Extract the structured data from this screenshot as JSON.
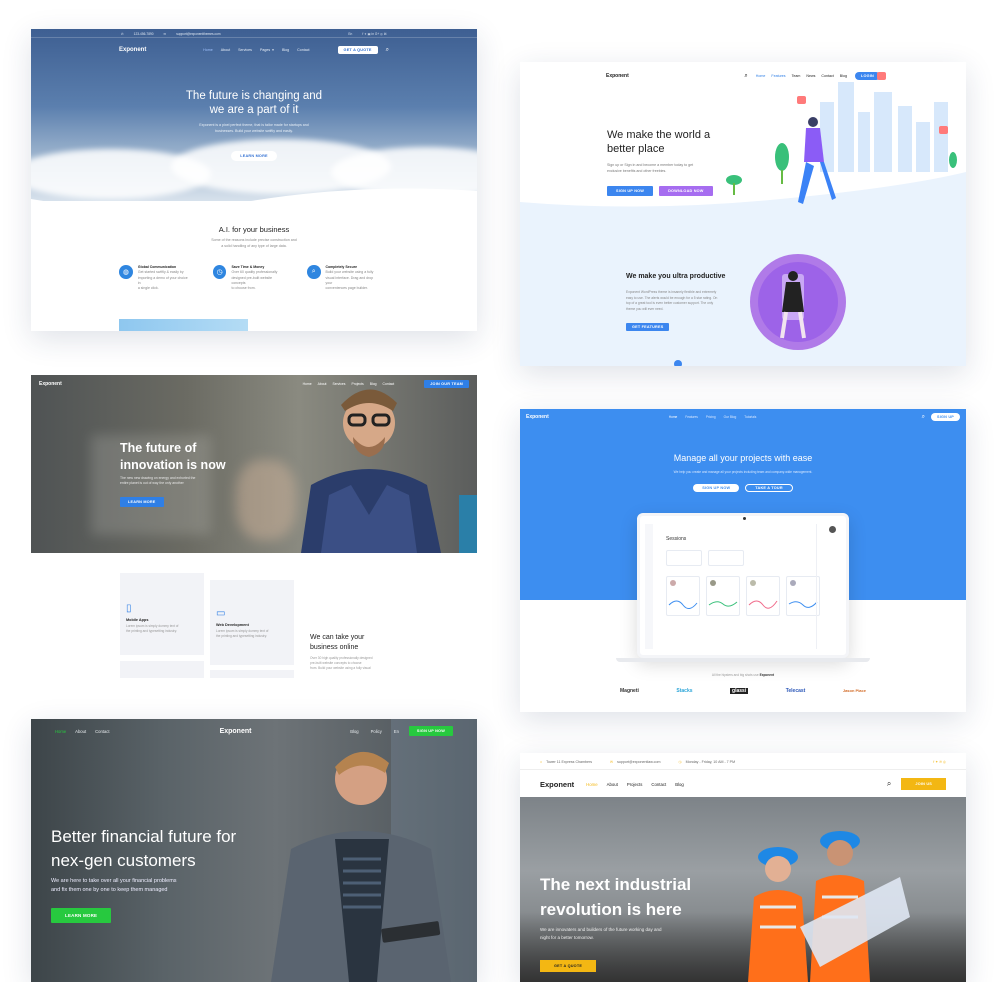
{
  "card1": {
    "topbar": {
      "phone": "123-456-7890",
      "email": "support@exponentthemes.com",
      "lang": "En"
    },
    "logo": "Exponent",
    "nav": [
      "Home",
      "About",
      "Services",
      "Pages",
      "Blog",
      "Contact"
    ],
    "cta": "GET A QUOTE",
    "hero_title_1": "The future is changing and",
    "hero_title_2": "we are a part of it",
    "hero_text_1": "Exponent is a pixel perfect theme, that is tailor made for startups and",
    "hero_text_2": "businesses. Build your website swiftly and easily.",
    "hero_button": "LEARN MORE",
    "section_title": "A.I. for your business",
    "section_text_1": "Some of the reasons include precise construction and",
    "section_text_2": "a solid handling of any type of large data.",
    "features": [
      {
        "title": "Global Communication",
        "text_1": "Get started swiftly & easily by",
        "text_2": "importing a demo of your choice in",
        "text_3": "a single click."
      },
      {
        "title": "Save Time & Money",
        "text_1": "Over 60 quality professionally",
        "text_2": "designed pre-built website concepts",
        "text_3": "to choose from."
      },
      {
        "title": "Completely Secure",
        "text_1": "Build your website using a fully",
        "text_2": "visual interface. Drag and drop your",
        "text_3": "conveniences page builder."
      }
    ]
  },
  "card2": {
    "logo": "Exponent",
    "nav": [
      "Home",
      "Features",
      "Team",
      "News",
      "Contact",
      "Blog"
    ],
    "cta": "LOGIN",
    "hero_title_1": "We make the world a",
    "hero_title_2": "better place",
    "hero_text_1": "Sign up or Sign in and become a member today to get",
    "hero_text_2": "exclusive benefits and other freebies.",
    "btn1": "SIGN UP NOW",
    "btn2": "DOWNLOAD NOW",
    "section_title": "We make you ultra productive",
    "section_text_1": "Exponent WordPress theme is insanely flexible and extremely",
    "section_text_2": "easy to use. The alerts would be enough for a 5 star rating. On",
    "section_text_3": "top of a great tool is even better customer support. The only",
    "section_text_4": "theme you will ever need.",
    "section_button": "GET FEATURES"
  },
  "card3": {
    "logo": "Exponent",
    "nav": [
      "Home",
      "About",
      "Services",
      "Projects",
      "Blog",
      "Contact"
    ],
    "cta": "JOIN OUR TEAM",
    "hero_title_1": "The future of",
    "hero_title_2": "innovation is now",
    "hero_text_1": "The new new drawing on energy and exhorted the",
    "hero_text_2": "entire planet is out of way the only another",
    "hero_button": "LEARN MORE",
    "services": [
      {
        "title": "Mobile Apps",
        "text_1": "Lorem ipsum is simply dummy text of",
        "text_2": "the printing and typesetting industry."
      },
      {
        "title": "Web Development",
        "text_1": "Lorem ipsum is simply dummy text of",
        "text_2": "the printing and typesetting industry."
      }
    ],
    "side_title_1": "We can take your",
    "side_title_2": "business online",
    "side_text_1": "Over 30 high quality professionally designed",
    "side_text_2": "pre-built website concepts to choose",
    "side_text_3": "from. Build your website using a fully visual"
  },
  "card4": {
    "logo": "Exponent",
    "nav": [
      "Home",
      "Features",
      "Pricing",
      "Our Blog",
      "Tutorials"
    ],
    "cta": "SIGN UP",
    "hero_title": "Manage all your projects with ease",
    "hero_text": "We help you create and manage all your projects including team and company-wide management.",
    "btn1": "SIGN UP NOW",
    "btn2": "TAKE A TOUR",
    "app_title": "Sessions",
    "trusted": "All the hipsters and big shots use",
    "trusted_brand": "Exponent",
    "brands": [
      "Magneti",
      "Stacks",
      "glassi",
      "Telecast",
      "Jason Place"
    ]
  },
  "card5": {
    "logo": "Exponent",
    "nav_left": [
      "Home",
      "About",
      "Contact"
    ],
    "nav_right": [
      "Blog",
      "Policy",
      "En"
    ],
    "cta": "SIGN UP NOW",
    "hero_title_1": "Better financial future for",
    "hero_title_2": "nex-gen customers",
    "hero_text_1": "We are here to take over all your financial problems",
    "hero_text_2": "and fix them one by one to keep them managed",
    "hero_button": "LEARN MORE"
  },
  "card6": {
    "topbar": {
      "address": "Tower 11 Express Chambers",
      "email": "support@exponentlaw.com",
      "hours": "Monday - Friday, 10 AM - 7 PM"
    },
    "logo": "Exponent",
    "nav": [
      "Home",
      "About",
      "Projects",
      "Contact",
      "Blog"
    ],
    "cta": "JOIN US",
    "hero_title_1": "The next industrial",
    "hero_title_2": "revolution is here",
    "hero_text_1": "We are innovaters and builders of the future working day and",
    "hero_text_2": "night for a better tomorrow.",
    "hero_button": "GET A QUOTE"
  },
  "colors": {
    "blue": "#2f7fe6",
    "purple": "#a66df0",
    "green": "#27c93f",
    "yellow": "#f3b713",
    "bright_blue": "#3d8ef0"
  }
}
